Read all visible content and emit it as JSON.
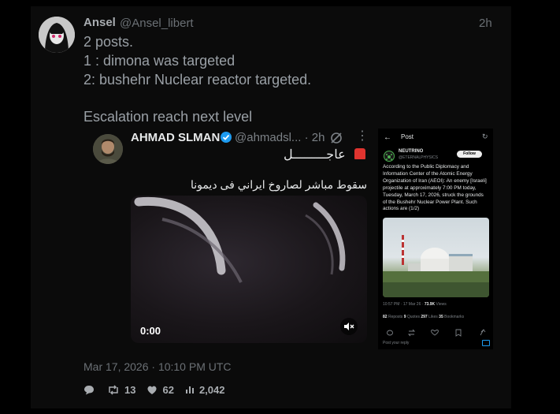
{
  "post": {
    "author_name": "Ansel",
    "author_handle": "@Ansel_libert",
    "time": "2h",
    "lines": [
      "2 posts.",
      "1 : dimona was targeted",
      "2: bushehr Nuclear reactor targeted.",
      "Escalation reach next level"
    ],
    "date": "Mar 17, 2026 · 10:10 PM UTC",
    "reposts": "13",
    "likes": "62",
    "views": "2,042"
  },
  "quote": {
    "name": "AHMAD SLMAN",
    "handle": "@ahmadsl... · 2h",
    "urgent_text": "عاجـــــــــل",
    "arabic_text": "سقوط مباشر لصاروخ ايراني فى ديمونا",
    "video_time": "0:00"
  },
  "screenshot": {
    "header_title": "Post",
    "author_name": "NEUTRINO",
    "author_handle": "@ETERNALPHYSICS",
    "follow_label": "Follow",
    "body": "According to the Public Diplomacy and Information Center of the Atomic Energy Organization of Iran (AEOI): An enemy [Israeli] projectile at approximately 7:00 PM today, Tuesday, March 17, 2026, struck the grounds of the Bushehr Nuclear Power Plant. Such actions are (1/2)",
    "meta_prefix": "10:57 PM · 17 Mar 26 · ",
    "meta_views": "73.9K",
    "meta_views_label": " Views",
    "reposts_count": "82",
    "reposts_label": " Reposts ",
    "quotes_count": "9",
    "quotes_label": " Quotes ",
    "likes_count": "297",
    "likes_label": " Likes ",
    "bookmarks_count": "35",
    "bookmarks_label": " Bookmarks",
    "reply_placeholder": "Post your reply"
  },
  "colors": {
    "verified": "#1d9bf0",
    "siren": "#e0342f",
    "background": "#000000"
  },
  "icons": [
    "reply-icon",
    "repost-icon",
    "like-icon",
    "views-icon",
    "verified-badge-icon",
    "mute-icon",
    "more-icon",
    "grok-icon",
    "back-arrow-icon",
    "refresh-icon",
    "siren-icon"
  ]
}
